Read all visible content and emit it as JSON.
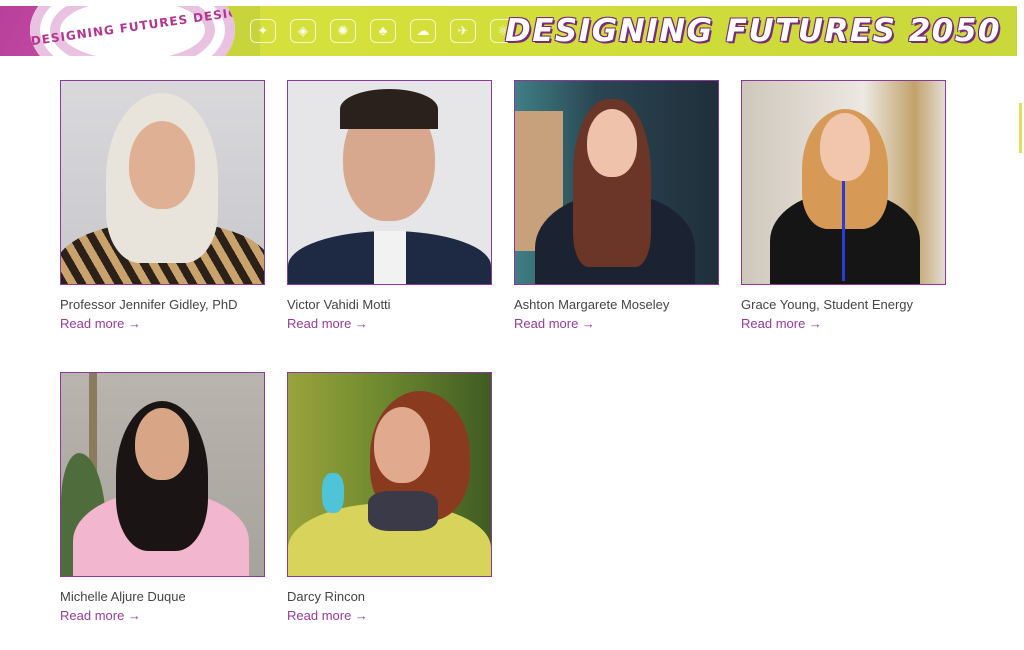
{
  "banner": {
    "title": "DESIGNING FUTURES 2050",
    "swirl_text": "DESIGNING FUTURES DESIGNING FUTURES"
  },
  "speakers": [
    {
      "name": "Professor Jennifer Gidley, PhD",
      "link": "Read more →"
    },
    {
      "name": "Victor Vahidi Motti",
      "link": "Read more →"
    },
    {
      "name": "Ashton Margarete Moseley",
      "link": "Read more →"
    },
    {
      "name": "Grace Young, Student Energy",
      "link": "Read more →"
    },
    {
      "name": "Michelle Aljure Duque",
      "link": "Read more →"
    },
    {
      "name": "Darcy Rincon",
      "link": "Read more →"
    }
  ],
  "colors": {
    "accent": "#9a3a9e",
    "banner": "#d4df3a",
    "frame": "#8a3a96"
  }
}
